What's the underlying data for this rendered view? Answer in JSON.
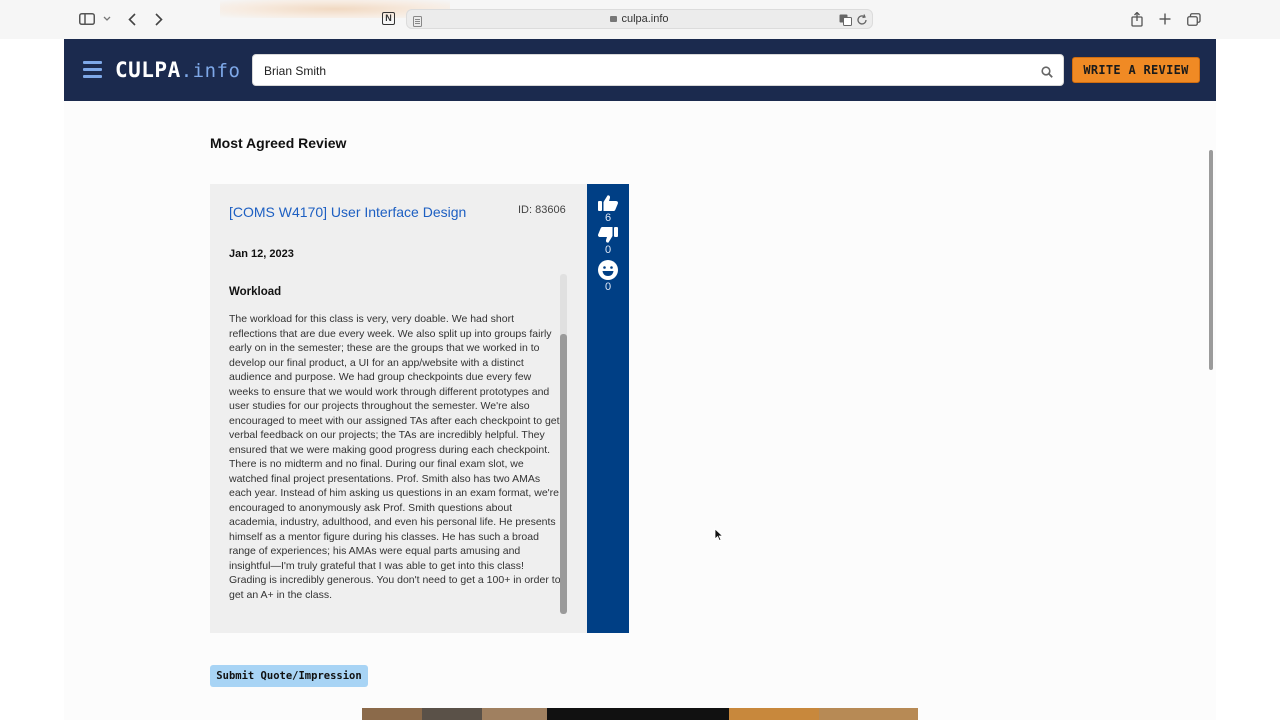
{
  "browser": {
    "url": "culpa.info",
    "icons": [
      "sidebar-icon",
      "chevron-down-icon",
      "back-icon",
      "forward-icon",
      "notion-icon",
      "reader-icon",
      "lock-icon",
      "translate-icon",
      "reload-icon",
      "share-icon",
      "new-tab-icon",
      "tabs-icon"
    ]
  },
  "header": {
    "logo_main": "CULPA",
    "logo_tld": ".info",
    "search_value": "Brian Smith",
    "write_button": "WRITE A REVIEW",
    "colors": {
      "bg": "#1b2a4e",
      "accent": "#7ea8e8",
      "cta": "#f08a24"
    }
  },
  "main": {
    "section_title": "Most Agreed Review",
    "review": {
      "course": "[COMS W4170] User Interface Design",
      "id_label": "ID: 83606",
      "date": "Jan 12, 2023",
      "section_heading": "Workload",
      "text": "The workload for this class is very, very doable. We had short reflections that are due every week. We also split up into groups fairly early on in the semester; these are the groups that we worked in to develop our final product, a UI for an app/website with a distinct audience and purpose. We had group checkpoints due every few weeks to ensure that we would work through different prototypes and user studies for our projects throughout the semester. We're also encouraged to meet with our assigned TAs after each checkpoint to get verbal feedback on our projects; the TAs are incredibly helpful. They ensured that we were making good progress during each checkpoint. There is no midterm and no final. During our final exam slot, we watched final project presentations. Prof. Smith also has two AMAs each year. Instead of him asking us questions in an exam format, we're encouraged to anonymously ask Prof. Smith questions about academia, industry, adulthood, and even his personal life. He presents himself as a mentor figure during his classes. He has such a broad range of experiences; his AMAs were equal parts amusing and insightful—I'm truly grateful that I was able to get into this class! Grading is incredibly generous. You don't need to get a 100+ in order to get an A+ in the class.",
      "votes": {
        "agree": "6",
        "disagree": "0",
        "funny": "0"
      }
    },
    "submit_button": "Submit Quote/Impression"
  }
}
